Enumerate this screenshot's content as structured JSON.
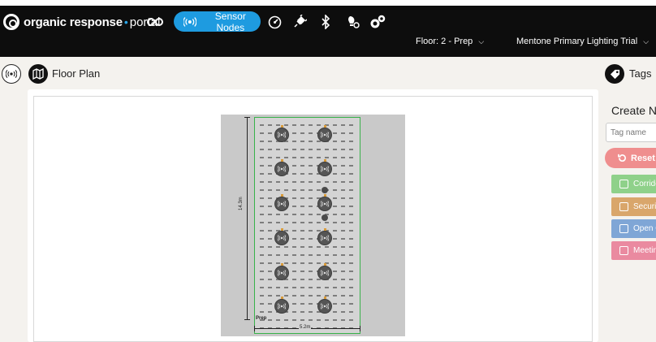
{
  "header": {
    "brand": "organic response",
    "separator": "•",
    "portal": "portal",
    "nav_active_label": "Sensor Nodes",
    "floor_dropdown": "Floor: 2 - Prep",
    "project_dropdown": "Mentone Primary Lighting Trial",
    "icons": [
      "glasses-icon",
      "sensor-icon",
      "gauge-icon",
      "plug-icon",
      "bluetooth-icon",
      "light-settings-icon",
      "cogs-icon"
    ]
  },
  "main": {
    "title": "Floor Plan"
  },
  "plan": {
    "room_label": "Prep",
    "vertical_dim": "14.3m",
    "horizontal_dim": "5.2m",
    "inner_dim": "2.4m"
  },
  "tags": {
    "title": "Tags",
    "create_label": "Create New",
    "input_placeholder": "Tag name",
    "reset_label": "Reset",
    "items": [
      {
        "label": "Corridor",
        "color": "#8fd18a"
      },
      {
        "label": "Security",
        "color": "#d9a66b"
      },
      {
        "label": "Open Office",
        "color": "#7fa6d6"
      },
      {
        "label": "Meeting",
        "color": "#ea8aa0"
      }
    ]
  },
  "colors": {
    "accent": "#1e9be0",
    "navbar": "#0d0d0d",
    "room_outline": "#38b24a",
    "reset": "#ef8e8e"
  }
}
